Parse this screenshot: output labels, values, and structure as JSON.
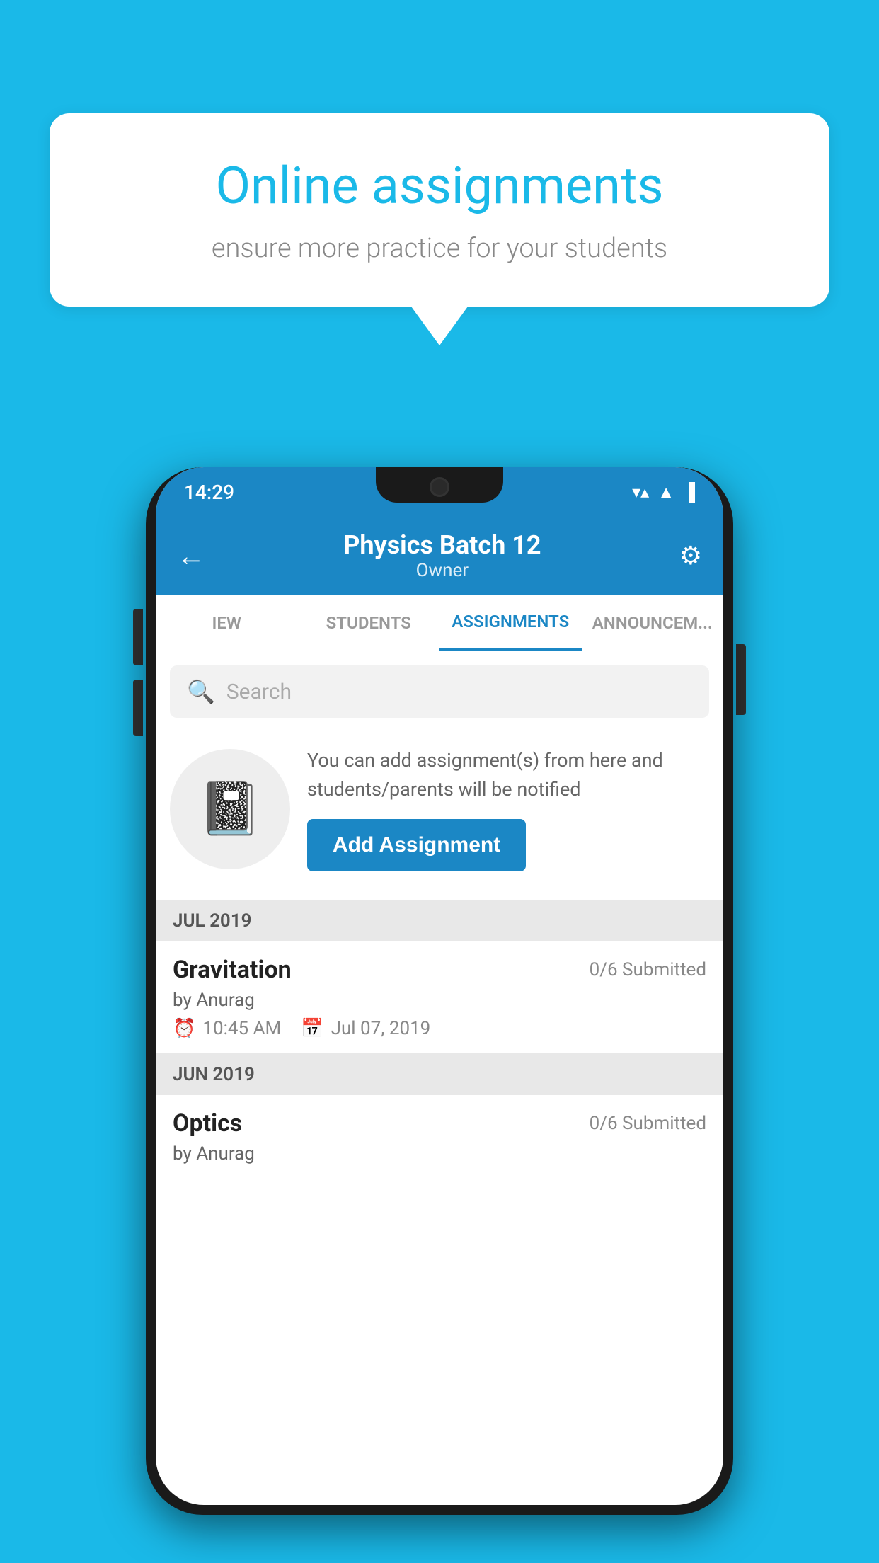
{
  "background": {
    "color": "#1ab9e8"
  },
  "speech_bubble": {
    "title": "Online assignments",
    "subtitle": "ensure more practice for your students"
  },
  "status_bar": {
    "time": "14:29",
    "wifi": "▼▲",
    "signal": "▲",
    "battery": "▐"
  },
  "header": {
    "title": "Physics Batch 12",
    "subtitle": "Owner",
    "back_label": "←",
    "settings_label": "⚙"
  },
  "tabs": [
    {
      "label": "IEW",
      "active": false
    },
    {
      "label": "STUDENTS",
      "active": false
    },
    {
      "label": "ASSIGNMENTS",
      "active": true
    },
    {
      "label": "ANNOUNCEMENTS",
      "active": false
    }
  ],
  "search": {
    "placeholder": "Search"
  },
  "promo": {
    "text": "You can add assignment(s) from here and students/parents will be notified",
    "button_label": "Add Assignment"
  },
  "sections": [
    {
      "header": "JUL 2019",
      "items": [
        {
          "name": "Gravitation",
          "status": "0/6 Submitted",
          "by": "by Anurag",
          "time": "10:45 AM",
          "date": "Jul 07, 2019"
        }
      ]
    },
    {
      "header": "JUN 2019",
      "items": [
        {
          "name": "Optics",
          "status": "0/6 Submitted",
          "by": "by Anurag",
          "time": "",
          "date": ""
        }
      ]
    }
  ]
}
